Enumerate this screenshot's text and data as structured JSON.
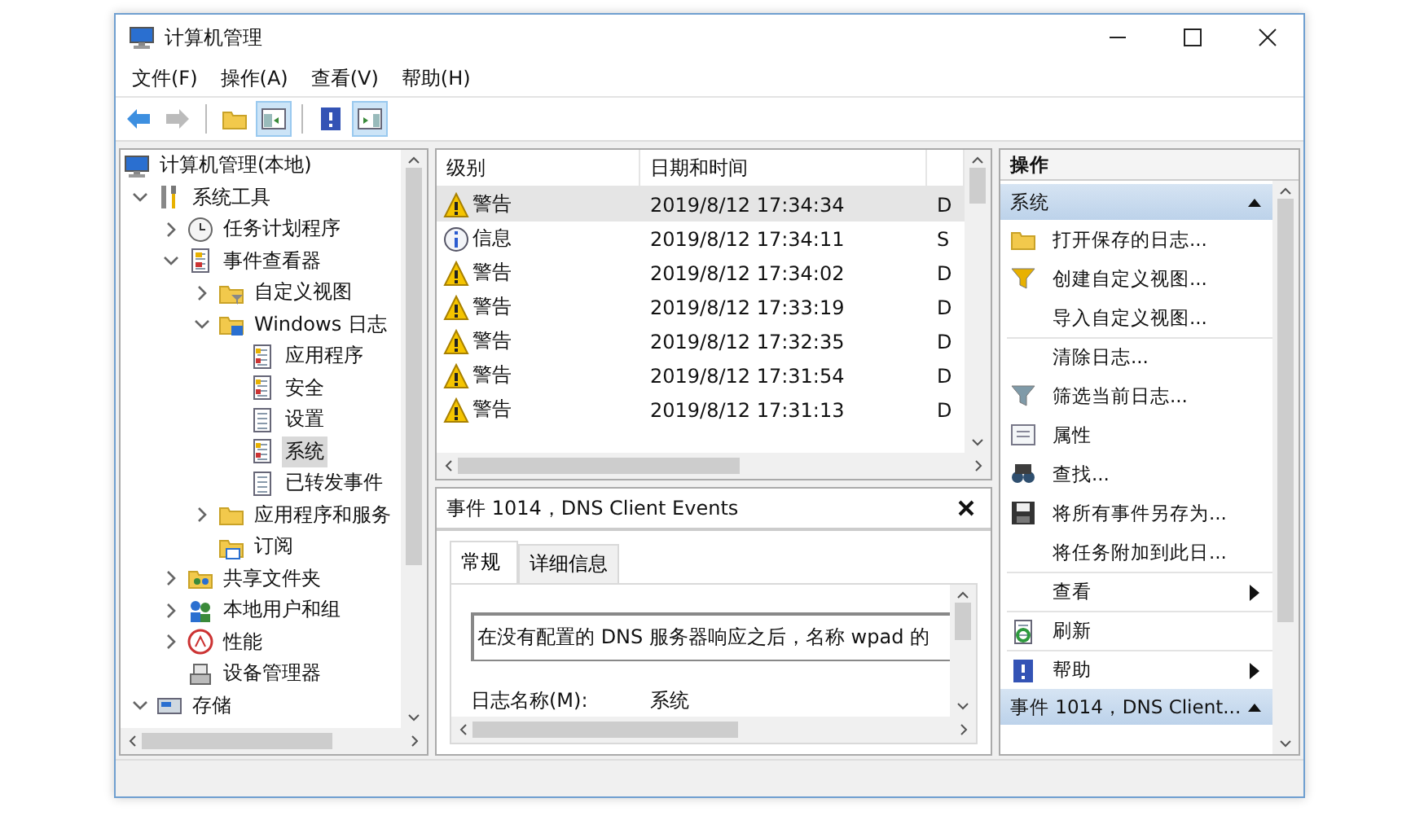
{
  "window": {
    "title": "计算机管理"
  },
  "menu": [
    "文件(F)",
    "操作(A)",
    "查看(V)",
    "帮助(H)"
  ],
  "toolbar": [
    {
      "kind": "back",
      "disabled": false,
      "pressed": false
    },
    {
      "kind": "forward",
      "disabled": true,
      "pressed": false
    },
    {
      "kind": "separator"
    },
    {
      "kind": "up",
      "disabled": false,
      "pressed": false
    },
    {
      "kind": "tree",
      "disabled": false,
      "pressed": true
    },
    {
      "kind": "separator"
    },
    {
      "kind": "help",
      "disabled": false,
      "pressed": false
    },
    {
      "kind": "actions",
      "disabled": false,
      "pressed": true
    }
  ],
  "tree": {
    "items": [
      {
        "label": "计算机管理(本地)",
        "kind": "computer",
        "selected": false,
        "children": [
          {
            "label": "系统工具",
            "kind": "tools",
            "expanded": true,
            "selected": false,
            "children": [
              {
                "label": "任务计划程序",
                "kind": "clock",
                "expanded": false,
                "selected": false
              },
              {
                "label": "事件查看器",
                "kind": "viewer",
                "expanded": true,
                "selected": false,
                "children": [
                  {
                    "label": "自定义视图",
                    "kind": "folder-filter",
                    "expanded": false,
                    "selected": false
                  },
                  {
                    "label": "Windows 日志",
                    "kind": "folder-log",
                    "expanded": true,
                    "selected": false,
                    "children": [
                      {
                        "label": "应用程序",
                        "kind": "log-warn",
                        "selected": false
                      },
                      {
                        "label": "安全",
                        "kind": "log-warn",
                        "selected": false
                      },
                      {
                        "label": "设置",
                        "kind": "log",
                        "selected": false
                      },
                      {
                        "label": "系统",
                        "kind": "log-warn",
                        "selected": true
                      },
                      {
                        "label": "已转发事件",
                        "kind": "log",
                        "selected": false
                      }
                    ]
                  },
                  {
                    "label": "应用程序和服务",
                    "kind": "folder",
                    "expanded": false,
                    "selected": false
                  },
                  {
                    "label": "订阅",
                    "kind": "folder-sub",
                    "selected": false
                  }
                ]
              },
              {
                "label": "共享文件夹",
                "kind": "share",
                "expanded": false,
                "selected": false
              },
              {
                "label": "本地用户和组",
                "kind": "users",
                "expanded": false,
                "selected": false
              },
              {
                "label": "性能",
                "kind": "perf",
                "expanded": false,
                "selected": false
              },
              {
                "label": "设备管理器",
                "kind": "device",
                "selected": false
              }
            ]
          },
          {
            "label": "存储",
            "kind": "storage",
            "expanded": true,
            "selected": false
          }
        ]
      }
    ]
  },
  "events": {
    "columns": [
      "级别",
      "日期和时间"
    ],
    "rows": [
      {
        "kind": "warning",
        "label": "警告",
        "datetime": "2019/8/12 17:34:34",
        "column_3": "D",
        "selected": true
      },
      {
        "kind": "info",
        "label": "信息",
        "datetime": "2019/8/12 17:34:11",
        "column_3": "S",
        "selected": false
      },
      {
        "kind": "warning",
        "label": "警告",
        "datetime": "2019/8/12 17:34:02",
        "column_3": "D",
        "selected": false
      },
      {
        "kind": "warning",
        "label": "警告",
        "datetime": "2019/8/12 17:33:19",
        "column_3": "D",
        "selected": false
      },
      {
        "kind": "warning",
        "label": "警告",
        "datetime": "2019/8/12 17:32:35",
        "column_3": "D",
        "selected": false
      },
      {
        "kind": "warning",
        "label": "警告",
        "datetime": "2019/8/12 17:31:54",
        "column_3": "D",
        "selected": false
      },
      {
        "kind": "warning",
        "label": "警告",
        "datetime": "2019/8/12 17:31:13",
        "column_3": "D",
        "selected": false
      }
    ]
  },
  "detail": {
    "title": "事件 1014，DNS Client Events",
    "tabs": [
      {
        "label": "常规",
        "selected": true
      },
      {
        "label": "详细信息",
        "selected": false
      }
    ],
    "description": "在没有配置的 DNS 服务器响应之后，名称 wpad 的",
    "fields": [
      {
        "label": "日志名称(M):",
        "value": "系统"
      }
    ]
  },
  "actions": {
    "title": "操作",
    "sections": [
      {
        "title": "系统",
        "expanded": true,
        "items": [
          {
            "label": "打开保存的日志...",
            "kind": "open-folder",
            "submenu": false,
            "separator_before": false
          },
          {
            "label": "创建自定义视图...",
            "kind": "filter-new",
            "submenu": false,
            "separator_before": false
          },
          {
            "label": "导入自定义视图...",
            "kind": "plain",
            "submenu": false,
            "separator_before": false
          },
          {
            "label": "清除日志...",
            "kind": "plain",
            "submenu": false,
            "separator_before": true
          },
          {
            "label": "筛选当前日志...",
            "kind": "filter",
            "submenu": false,
            "separator_before": false
          },
          {
            "label": "属性",
            "kind": "properties",
            "submenu": false,
            "separator_before": false
          },
          {
            "label": "查找...",
            "kind": "find",
            "submenu": false,
            "separator_before": false
          },
          {
            "label": "将所有事件另存为...",
            "kind": "save",
            "submenu": false,
            "separator_before": false
          },
          {
            "label": "将任务附加到此日...",
            "kind": "plain",
            "submenu": false,
            "separator_before": false
          },
          {
            "label": "查看",
            "kind": "plain",
            "submenu": true,
            "separator_before": true
          },
          {
            "label": "刷新",
            "kind": "refresh",
            "submenu": false,
            "separator_before": true
          },
          {
            "label": "帮助",
            "kind": "help",
            "submenu": true,
            "separator_before": true
          }
        ]
      },
      {
        "title": "事件 1014，DNS Client...",
        "expanded": true
      }
    ]
  }
}
